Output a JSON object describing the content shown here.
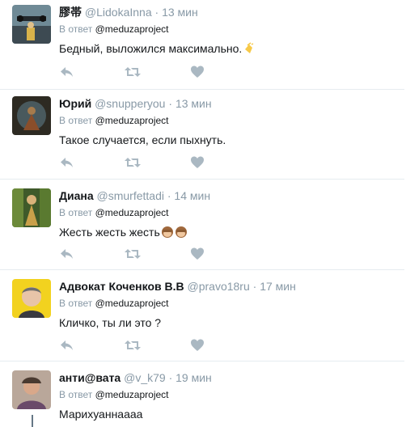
{
  "colors": {
    "meta": "#8899a6",
    "divider": "#e6ecf0",
    "icon": "#aab8c2",
    "text": "#14171a"
  },
  "tweets": [
    {
      "name": "膠帯",
      "handle": "@LidokaInna",
      "sep": "·",
      "time": "13 мин",
      "reply_label": "В ответ",
      "reply_mention": "@meduzaproject",
      "text": "Бедный, выложился максимально.",
      "emoji": [
        "clapping-hands"
      ]
    },
    {
      "name": "Юрий",
      "handle": "@snupperyou",
      "sep": "·",
      "time": "13 мин",
      "reply_label": "В ответ",
      "reply_mention": "@meduzaproject",
      "text": "Такое случается, если пыхнуть.",
      "emoji": []
    },
    {
      "name": "Диана",
      "handle": "@smurfettadi",
      "sep": "·",
      "time": "14 мин",
      "reply_label": "В ответ",
      "reply_mention": "@meduzaproject",
      "text": "Жесть жесть жесть",
      "emoji": [
        "see-no-evil-monkey",
        "see-no-evil-monkey"
      ]
    },
    {
      "name": "Адвокат Коченков В.В",
      "handle": "@pravo18ru",
      "sep": "·",
      "time": "17 мин",
      "reply_label": "В ответ",
      "reply_mention": "@meduzaproject",
      "text": "Кличко, ты ли это ?",
      "emoji": []
    },
    {
      "name": "анти@вата",
      "handle": "@v_k79",
      "sep": "·",
      "time": "19 мин",
      "reply_label": "В ответ",
      "reply_mention": "@meduzaproject",
      "text": "Марихуаннаааа",
      "emoji": []
    }
  ],
  "actions": [
    "reply-icon",
    "retweet-icon",
    "like-icon"
  ]
}
